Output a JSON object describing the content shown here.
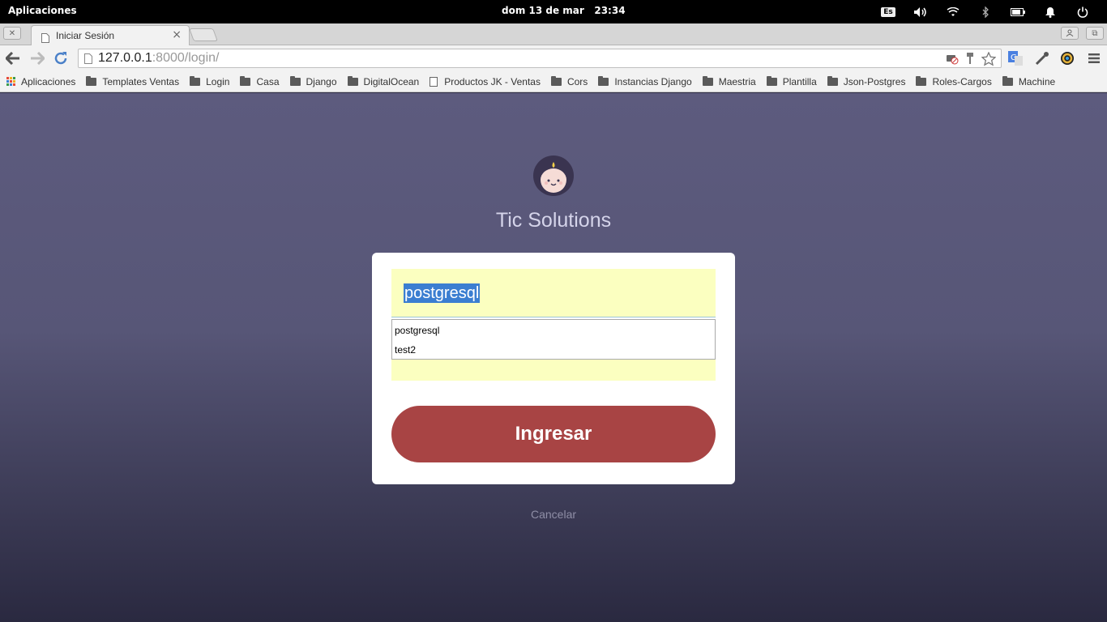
{
  "system_bar": {
    "activities_label": "Aplicaciones",
    "datetime": "dom 13 de mar   23:34",
    "keyboard_layout": "Es"
  },
  "browser": {
    "tab_title": "Iniciar Sesión",
    "url_host": "127.0.0.1",
    "url_rest": ":8000/login/",
    "bookmarks": [
      {
        "label": "Aplicaciones",
        "icon": "apps-grid-icon"
      },
      {
        "label": "Templates Ventas",
        "icon": "folder-icon"
      },
      {
        "label": "Login",
        "icon": "folder-icon"
      },
      {
        "label": "Casa",
        "icon": "folder-icon"
      },
      {
        "label": "Django",
        "icon": "folder-icon"
      },
      {
        "label": "DigitalOcean",
        "icon": "folder-icon"
      },
      {
        "label": "Productos JK - Ventas",
        "icon": "page-icon"
      },
      {
        "label": "Cors",
        "icon": "folder-icon"
      },
      {
        "label": "Instancias Django",
        "icon": "folder-icon"
      },
      {
        "label": "Maestria",
        "icon": "folder-icon"
      },
      {
        "label": "Plantilla",
        "icon": "folder-icon"
      },
      {
        "label": "Json-Postgres",
        "icon": "folder-icon"
      },
      {
        "label": "Roles-Cargos",
        "icon": "folder-icon"
      },
      {
        "label": "Machine",
        "icon": "folder-icon"
      }
    ]
  },
  "login": {
    "brand": "Tic Solutions",
    "username_value": "postgresql",
    "autocomplete": [
      "postgresql",
      "test2"
    ],
    "submit_label": "Ingresar",
    "cancel_label": "Cancelar"
  },
  "colors": {
    "accent": "#a84444",
    "autofill": "#fbffc0",
    "selection": "#3b7ed1"
  }
}
